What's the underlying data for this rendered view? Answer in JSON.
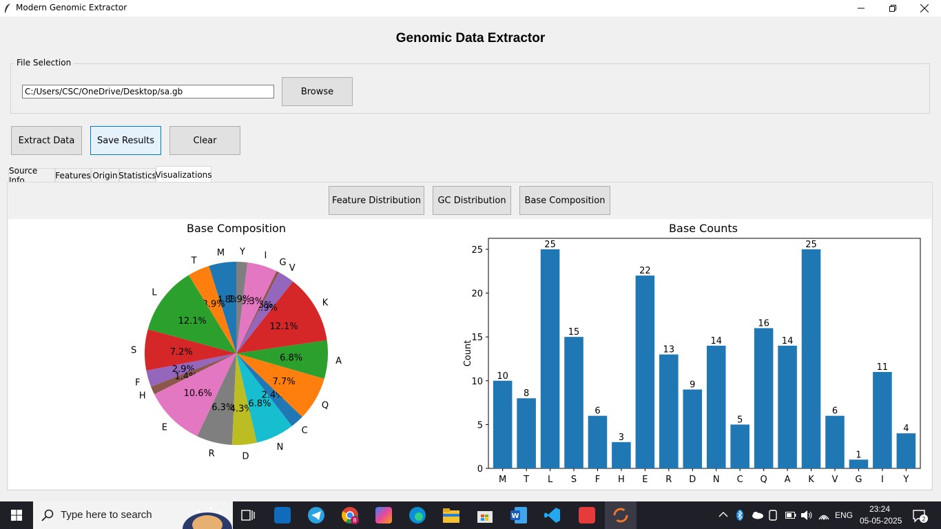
{
  "window": {
    "title": "Modern Genomic Extractor"
  },
  "app": {
    "heading": "Genomic Data Extractor",
    "file_selection": {
      "label": "File Selection",
      "path_value": "C:/Users/CSC/OneDrive/Desktop/sa.gb",
      "browse_label": "Browse"
    },
    "actions": {
      "extract_label": "Extract Data",
      "save_label": "Save Results",
      "clear_label": "Clear"
    },
    "tabs": [
      {
        "label": "Source Info"
      },
      {
        "label": "Features"
      },
      {
        "label": "Origin"
      },
      {
        "label": "Statistics"
      },
      {
        "label": "Visualizations",
        "active": true
      }
    ],
    "viz_buttons": {
      "feature_label": "Feature Distribution",
      "gc_label": "GC Distribution",
      "base_label": "Base Composition"
    }
  },
  "chart_data": [
    {
      "type": "pie",
      "title": "Base Composition",
      "labels": [
        "M",
        "T",
        "L",
        "S",
        "F",
        "H",
        "E",
        "R",
        "D",
        "N",
        "C",
        "Q",
        "A",
        "K",
        "V",
        "G",
        "I",
        "Y"
      ],
      "values": [
        10,
        8,
        25,
        15,
        6,
        3,
        22,
        13,
        9,
        14,
        5,
        16,
        14,
        25,
        6,
        1,
        11,
        4
      ],
      "percent_labels": [
        "4.8%",
        "3.9%",
        "12.1%",
        "7.2%",
        "2.9%",
        "1.4%",
        "10.6%",
        "6.3%",
        "4.3%",
        "6.8%",
        "2.4%",
        "7.7%",
        "6.8%",
        "12.1%",
        "2.9%",
        "0.5%",
        "5.3%",
        "1.9%"
      ],
      "colors": [
        "#1f77b4",
        "#ff7f0e",
        "#2ca02c",
        "#d62728",
        "#9467bd",
        "#8c564b",
        "#e377c2",
        "#7f7f7f",
        "#bcbd22",
        "#17becf",
        "#1f77b4",
        "#ff7f0e",
        "#2ca02c",
        "#d62728",
        "#9467bd",
        "#8c564b",
        "#e377c2",
        "#7f7f7f"
      ],
      "start_angle_deg": 90,
      "direction": "counterclockwise"
    },
    {
      "type": "bar",
      "title": "Base Counts",
      "categories": [
        "M",
        "T",
        "L",
        "S",
        "F",
        "H",
        "E",
        "R",
        "D",
        "N",
        "C",
        "Q",
        "A",
        "K",
        "V",
        "G",
        "I",
        "Y"
      ],
      "values": [
        10,
        8,
        25,
        15,
        6,
        3,
        22,
        13,
        9,
        14,
        5,
        16,
        14,
        25,
        6,
        1,
        11,
        4
      ],
      "xlabel": "",
      "ylabel": "Count",
      "ylim": [
        0,
        26.25
      ],
      "yticks": [
        0,
        5,
        10,
        15,
        20,
        25
      ],
      "color": "#1f77b4",
      "data_labels": true
    }
  ],
  "taskbar": {
    "search_placeholder": "Type here to search",
    "language": "ENG",
    "time": "23:24",
    "date": "05-05-2025",
    "notification_count": "2",
    "chrome_badge": "8"
  }
}
